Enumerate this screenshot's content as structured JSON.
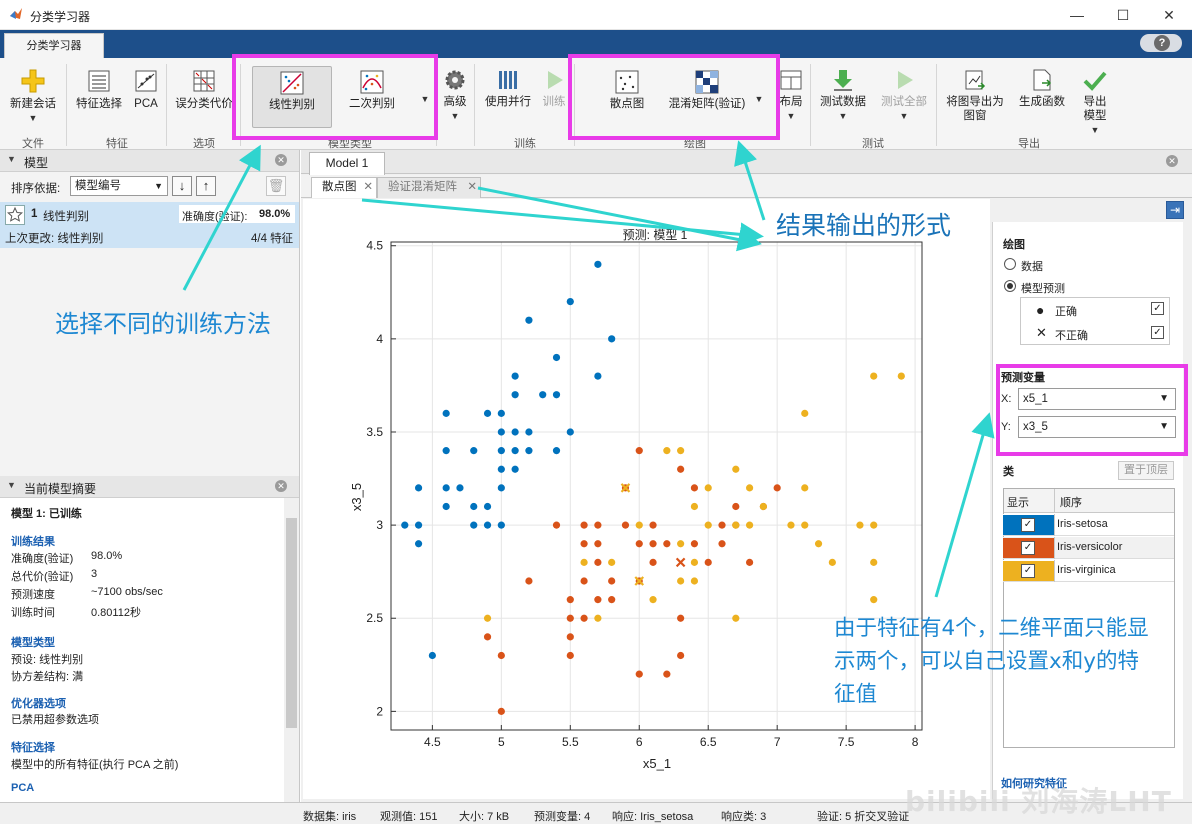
{
  "window": {
    "title": "分类学习器"
  },
  "apptab": "分类学习器",
  "toolstrip": {
    "buttons": {
      "new_session": "新建会话",
      "feature_select": "特征选择",
      "pca": "PCA",
      "misclass_cost": "误分类代价",
      "linear_disc": "线性判别",
      "quad_disc": "二次判别",
      "advanced": "高级",
      "use_parallel": "使用并行",
      "train": "训练",
      "scatter": "散点图",
      "confusion": "混淆矩阵(验证)",
      "layout": "布局",
      "test_data": "测试数据",
      "test_all": "测试全部",
      "export_plot": "将图导出为图窗",
      "gen_func": "生成函数",
      "export_model": "导出模型"
    },
    "groups": {
      "file": "文件",
      "features": "特征",
      "options": "选项",
      "model_type": "模型类型",
      "training": "训练",
      "plots": "绘图",
      "test": "测试",
      "export": "导出"
    }
  },
  "models_pane": {
    "title": "模型",
    "sort_label": "排序依据:",
    "sort_value": "模型编号",
    "model": {
      "number": "1",
      "name": "线性判别",
      "accuracy_label": "准确度(验证):",
      "accuracy": "98.0%",
      "last_change": "上次更改: 线性判别",
      "features": "4/4 特征"
    }
  },
  "summary": {
    "title": "当前模型摘要",
    "model_line": "模型 1: 已训练",
    "train_results": "训练结果",
    "rows": [
      {
        "k": "准确度(验证)",
        "v": "98.0%"
      },
      {
        "k": "总代价(验证)",
        "v": "3"
      },
      {
        "k": "预测速度",
        "v": "~7100 obs/sec"
      },
      {
        "k": "训练时间",
        "v": "0.80112秒"
      }
    ],
    "model_type": "模型类型",
    "preset": "预设: 线性判别",
    "cov": "协方差结构: 满",
    "optimizer": "优化器选项",
    "hyper": "已禁用超参数选项",
    "feat_sel": "特征选择",
    "feat_desc": "模型中的所有特征(执行 PCA 之前)",
    "pca": "PCA"
  },
  "doc": {
    "model_tab": "Model 1",
    "tab_scatter": "散点图",
    "tab_confusion": "验证混淆矩阵"
  },
  "chart_data": {
    "type": "scatter",
    "title": "预测: 模型 1",
    "xlabel": "x5_1",
    "ylabel": "x3_5",
    "xlim": [
      4.2,
      8.05
    ],
    "ylim": [
      1.9,
      4.52
    ],
    "xticks": [
      "4.5",
      "5",
      "5.5",
      "6",
      "6.5",
      "7",
      "7.5",
      "8"
    ],
    "yticks": [
      "2",
      "2.5",
      "3",
      "3.5",
      "4",
      "4.5"
    ],
    "grid": true,
    "series": [
      {
        "name": "Iris-setosa",
        "color": "#0072bd",
        "correct": [
          [
            4.3,
            3.0
          ],
          [
            4.4,
            2.9
          ],
          [
            4.4,
            3.0
          ],
          [
            4.4,
            3.2
          ],
          [
            4.5,
            2.3
          ],
          [
            4.6,
            3.1
          ],
          [
            4.6,
            3.2
          ],
          [
            4.6,
            3.4
          ],
          [
            4.6,
            3.6
          ],
          [
            4.7,
            3.2
          ],
          [
            4.8,
            3.0
          ],
          [
            4.8,
            3.1
          ],
          [
            4.8,
            3.4
          ],
          [
            4.9,
            3.0
          ],
          [
            4.9,
            3.1
          ],
          [
            4.9,
            3.6
          ],
          [
            5.0,
            3.0
          ],
          [
            5.0,
            3.2
          ],
          [
            5.0,
            3.3
          ],
          [
            5.0,
            3.4
          ],
          [
            5.0,
            3.5
          ],
          [
            5.0,
            3.6
          ],
          [
            5.1,
            3.3
          ],
          [
            5.1,
            3.4
          ],
          [
            5.1,
            3.5
          ],
          [
            5.1,
            3.7
          ],
          [
            5.1,
            3.8
          ],
          [
            5.2,
            3.4
          ],
          [
            5.2,
            3.5
          ],
          [
            5.2,
            4.1
          ],
          [
            5.3,
            3.7
          ],
          [
            5.4,
            3.4
          ],
          [
            5.4,
            3.7
          ],
          [
            5.4,
            3.9
          ],
          [
            5.5,
            3.5
          ],
          [
            5.5,
            4.2
          ],
          [
            5.7,
            3.8
          ],
          [
            5.7,
            4.4
          ],
          [
            5.8,
            4.0
          ]
        ],
        "wrong": []
      },
      {
        "name": "Iris-versicolor",
        "color": "#d95319",
        "correct": [
          [
            4.9,
            2.4
          ],
          [
            5.0,
            2.0
          ],
          [
            5.0,
            2.3
          ],
          [
            5.2,
            2.7
          ],
          [
            5.4,
            3.0
          ],
          [
            5.5,
            2.3
          ],
          [
            5.5,
            2.4
          ],
          [
            5.5,
            2.5
          ],
          [
            5.5,
            2.6
          ],
          [
            5.6,
            2.5
          ],
          [
            5.6,
            2.7
          ],
          [
            5.6,
            2.9
          ],
          [
            5.6,
            3.0
          ],
          [
            5.7,
            2.6
          ],
          [
            5.7,
            2.8
          ],
          [
            5.7,
            2.9
          ],
          [
            5.7,
            3.0
          ],
          [
            5.8,
            2.6
          ],
          [
            5.8,
            2.7
          ],
          [
            5.9,
            3.0
          ],
          [
            5.9,
            3.2
          ],
          [
            6.0,
            2.2
          ],
          [
            6.0,
            2.7
          ],
          [
            6.0,
            2.9
          ],
          [
            6.0,
            3.4
          ],
          [
            6.1,
            2.8
          ],
          [
            6.1,
            2.9
          ],
          [
            6.1,
            3.0
          ],
          [
            6.2,
            2.2
          ],
          [
            6.2,
            2.9
          ],
          [
            6.3,
            2.3
          ],
          [
            6.3,
            2.5
          ],
          [
            6.3,
            3.3
          ],
          [
            6.4,
            2.9
          ],
          [
            6.4,
            3.2
          ],
          [
            6.5,
            2.8
          ],
          [
            6.6,
            2.9
          ],
          [
            6.6,
            3.0
          ],
          [
            6.7,
            3.0
          ],
          [
            6.7,
            3.1
          ],
          [
            6.8,
            2.8
          ],
          [
            6.9,
            3.1
          ],
          [
            7.0,
            3.2
          ]
        ],
        "wrong": [
          [
            6.3,
            2.8
          ]
        ]
      },
      {
        "name": "Iris-virginica",
        "color": "#edb120",
        "correct": [
          [
            4.9,
            2.5
          ],
          [
            5.6,
            2.8
          ],
          [
            5.7,
            2.5
          ],
          [
            5.8,
            2.8
          ],
          [
            6.0,
            3.0
          ],
          [
            6.1,
            2.6
          ],
          [
            6.2,
            3.4
          ],
          [
            6.3,
            2.7
          ],
          [
            6.3,
            2.9
          ],
          [
            6.3,
            3.4
          ],
          [
            6.4,
            2.7
          ],
          [
            6.4,
            2.8
          ],
          [
            6.4,
            3.1
          ],
          [
            6.5,
            3.0
          ],
          [
            6.5,
            3.2
          ],
          [
            6.7,
            2.5
          ],
          [
            6.7,
            3.0
          ],
          [
            6.7,
            3.3
          ],
          [
            6.8,
            3.0
          ],
          [
            6.8,
            3.2
          ],
          [
            6.9,
            3.1
          ],
          [
            7.1,
            3.0
          ],
          [
            7.2,
            3.0
          ],
          [
            7.2,
            3.2
          ],
          [
            7.2,
            3.6
          ],
          [
            7.3,
            2.9
          ],
          [
            7.4,
            2.8
          ],
          [
            7.6,
            3.0
          ],
          [
            7.7,
            2.6
          ],
          [
            7.7,
            2.8
          ],
          [
            7.7,
            3.0
          ],
          [
            7.7,
            3.8
          ],
          [
            7.9,
            3.8
          ]
        ],
        "wrong": [
          [
            5.9,
            3.2
          ],
          [
            6.0,
            2.7
          ]
        ]
      }
    ]
  },
  "right_panel": {
    "plot_title": "绘图",
    "data": "数据",
    "model_pred": "模型预测",
    "correct": "正确",
    "incorrect": "不正确",
    "pred_var": "预测变量",
    "x_label": "X:",
    "x_value": "x5_1",
    "y_label": "Y:",
    "y_value": "x3_5",
    "classes": "类",
    "bring_top": "置于顶层",
    "col_show": "显示",
    "col_order": "顺序",
    "how_to": "如何研究特征",
    "class_rows": [
      {
        "name": "Iris-setosa",
        "color": "#0072bd"
      },
      {
        "name": "Iris-versicolor",
        "color": "#d95319"
      },
      {
        "name": "Iris-virginica",
        "color": "#edb120"
      }
    ]
  },
  "status": {
    "dataset": "数据集: iris",
    "obs": "观测值: 151",
    "size": "大小: 7 kB",
    "pred": "预测变量: 4",
    "resp": "响应: Iris_setosa",
    "resp_classes": "响应类: 3",
    "validation": "验证: 5 折交叉验证"
  },
  "annotations": {
    "choose_method": "选择不同的训练方法",
    "output_form": "结果输出的形式",
    "feature_note": [
      "由于特征有4个，二维平面只能显",
      "示两个，可以自己设置x和y的特",
      "征值"
    ]
  },
  "watermark": "bilibili 刘海涛LHT",
  "colors": {
    "accent_blue": "#1d4f8a",
    "highlight": "#e83be8",
    "annotation": "#1e88d2",
    "arrow": "#2fd4cf"
  }
}
